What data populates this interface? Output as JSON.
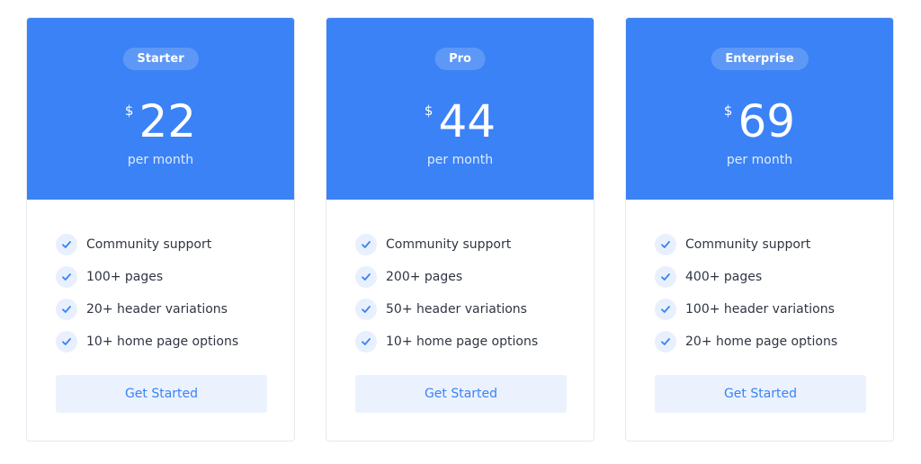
{
  "colors": {
    "accent": "#3b82f6",
    "badge_bg": "#5b97f7",
    "button_bg": "#ebf2fe",
    "check_bg": "#e8f0fe",
    "text": "#2f3542"
  },
  "plans": [
    {
      "name": "Starter",
      "currency": "$",
      "price": "22",
      "period": "per month",
      "features": [
        {
          "icon": "check-icon",
          "label": "Community support"
        },
        {
          "icon": "check-icon",
          "label": "100+ pages"
        },
        {
          "icon": "check-icon",
          "label": "20+ header variations"
        },
        {
          "icon": "check-icon",
          "label": "10+ home page options"
        }
      ],
      "cta_label": "Get Started"
    },
    {
      "name": "Pro",
      "currency": "$",
      "price": "44",
      "period": "per month",
      "features": [
        {
          "icon": "check-icon",
          "label": "Community support"
        },
        {
          "icon": "check-icon",
          "label": "200+ pages"
        },
        {
          "icon": "check-icon",
          "label": "50+ header variations"
        },
        {
          "icon": "check-icon",
          "label": "10+ home page options"
        }
      ],
      "cta_label": "Get Started"
    },
    {
      "name": "Enterprise",
      "currency": "$",
      "price": "69",
      "period": "per month",
      "features": [
        {
          "icon": "check-icon",
          "label": "Community support"
        },
        {
          "icon": "check-icon",
          "label": "400+ pages"
        },
        {
          "icon": "check-icon",
          "label": "100+ header variations"
        },
        {
          "icon": "check-icon",
          "label": "20+ home page options"
        }
      ],
      "cta_label": "Get Started"
    }
  ]
}
